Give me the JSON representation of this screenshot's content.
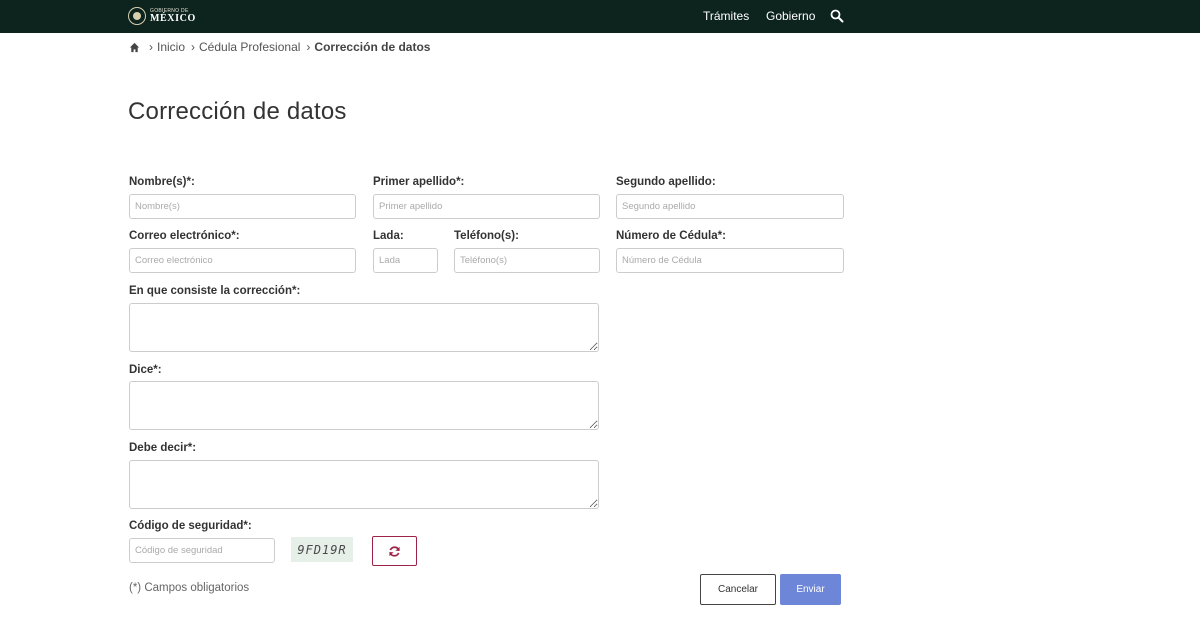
{
  "header": {
    "logo_small": "GOBIERNO DE",
    "logo_big": "MÉXICO",
    "nav": [
      "Trámites",
      "Gobierno"
    ],
    "search_icon": "search-icon"
  },
  "breadcrumb": {
    "home_icon": "home-icon",
    "items": [
      "Inicio",
      "Cédula Profesional",
      "Corrección de datos"
    ],
    "separator": "›"
  },
  "page_title": "Corrección de datos",
  "form": {
    "nombre": {
      "label": "Nombre(s)*:",
      "placeholder": "Nombre(s)"
    },
    "primer_apellido": {
      "label": "Primer apellido*:",
      "placeholder": "Primer apellido"
    },
    "segundo_apellido": {
      "label": "Segundo apellido:",
      "placeholder": "Segundo apellido"
    },
    "correo": {
      "label": "Correo electrónico*:",
      "placeholder": "Correo electrónico"
    },
    "lada": {
      "label": "Lada:",
      "placeholder": "Lada"
    },
    "telefono": {
      "label": "Teléfono(s):",
      "placeholder": "Teléfono(s)"
    },
    "cedula": {
      "label": "Número de Cédula*:",
      "placeholder": "Número de Cédula"
    },
    "correccion": {
      "label": "En que consiste la corrección*:"
    },
    "dice": {
      "label": "Dice*:"
    },
    "debe_decir": {
      "label": "Debe decir*:"
    },
    "codigo": {
      "label": "Código de seguridad*:",
      "placeholder": "Código de seguridad"
    },
    "captcha_text": "9FD19R",
    "refresh_icon": "refresh-icon",
    "required_note": "(*) Campos obligatorios",
    "cancel_label": "Cancelar",
    "submit_label": "Enviar"
  },
  "colors": {
    "topbar": "#0c231e",
    "accent": "#9d2449",
    "submit": "#6e86d8"
  }
}
